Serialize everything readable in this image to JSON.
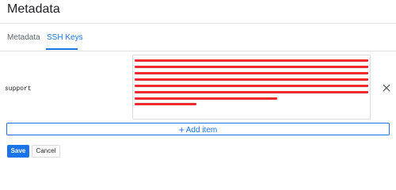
{
  "header": {
    "title": "Metadata"
  },
  "tabs": [
    {
      "label": "Metadata",
      "active": false
    },
    {
      "label": "SSH Keys",
      "active": true
    }
  ],
  "ssh_keys": {
    "rows": [
      {
        "username": "support",
        "key_redacted": true
      }
    ],
    "add_item_label": "Add item",
    "add_icon": "plus-icon",
    "remove_icon": "close-icon"
  },
  "actions": {
    "save_label": "Save",
    "cancel_label": "Cancel"
  },
  "colors": {
    "accent": "#1a73e8",
    "redaction": "#ee2a2a",
    "border": "#dadce0"
  }
}
